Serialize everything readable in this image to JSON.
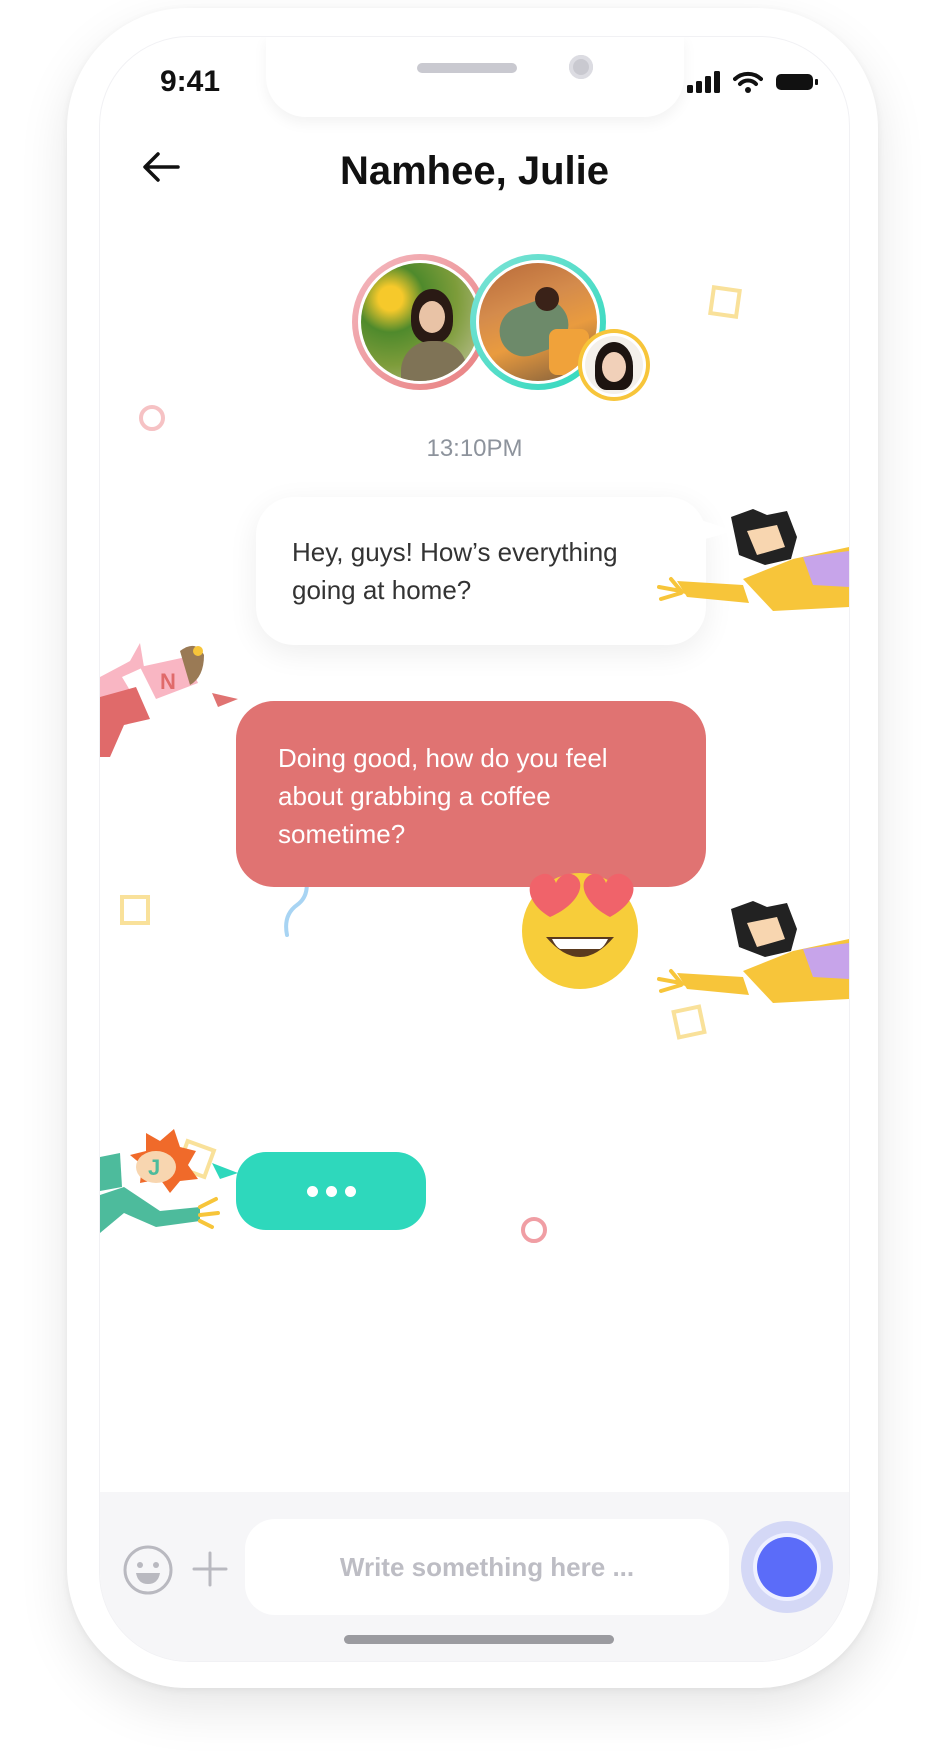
{
  "status_bar": {
    "time": "9:41"
  },
  "header": {
    "title": "Namhee, Julie"
  },
  "chat": {
    "timestamp": "13:10PM",
    "messages": [
      {
        "sender": "me",
        "text": "Hey, guys! How’s everything going at home?"
      },
      {
        "sender": "Namhee",
        "initial": "N",
        "text": "Doing good, how do you feel about grabbing a coffee sometime?"
      },
      {
        "sender": "me",
        "emoji": "heart-eyes"
      },
      {
        "sender": "Julie",
        "initial": "J",
        "typing": true
      }
    ]
  },
  "composer": {
    "placeholder": "Write something here ..."
  },
  "colors": {
    "outgoing_bubble": "#ffffff",
    "incoming_bubble": "#e07372",
    "typing_bubble": "#2ed8bc",
    "send_button": "#5b6cf9",
    "avatar_ring_pink": "#f0a0a8",
    "avatar_ring_teal": "#2ed8bc",
    "avatar_ring_yellow": "#f7c53a"
  },
  "icons": [
    "back-arrow-icon",
    "signal-icon",
    "wifi-icon",
    "battery-icon",
    "emoji-icon",
    "plus-icon",
    "send-icon"
  ]
}
